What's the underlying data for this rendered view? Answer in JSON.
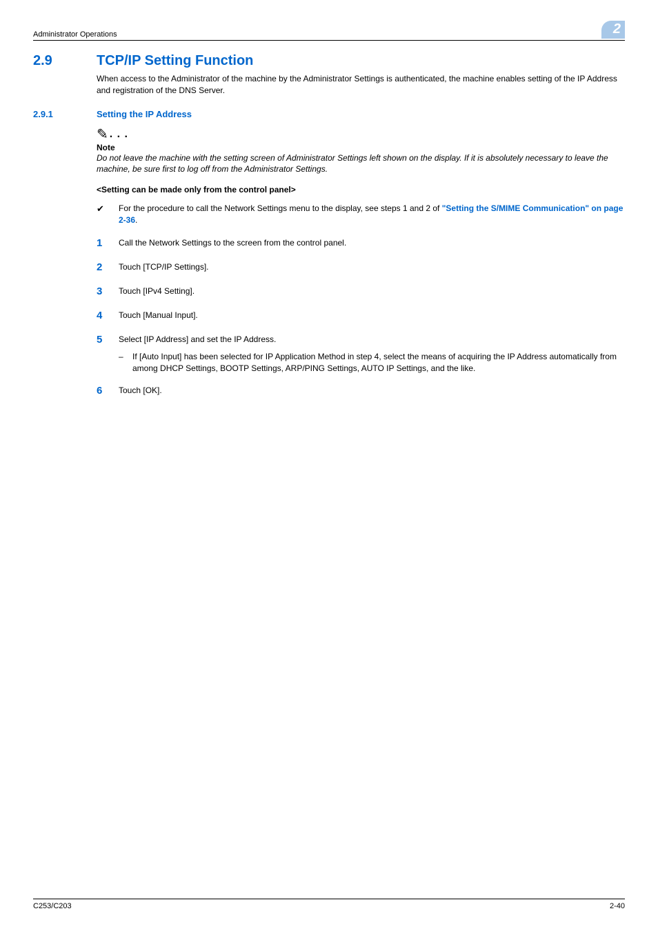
{
  "header": {
    "breadcrumb": "Administrator Operations",
    "chapter_num": "2"
  },
  "section29": {
    "num": "2.9",
    "title": "TCP/IP Setting Function",
    "intro": "When access to the Administrator of the machine by the Administrator Settings is authenticated, the machine enables setting of the IP Address and registration of the DNS Server."
  },
  "section291": {
    "num": "2.9.1",
    "title": "Setting the IP Address"
  },
  "note": {
    "icon": "✎",
    "dots": ". . .",
    "label": "Note",
    "text": "Do not leave the machine with the setting screen of Administrator Settings left shown on the display. If it is absolutely necessary to leave the machine, be sure first to log off from the Administrator Settings."
  },
  "panel_title": "<Setting can be made only from the control panel>",
  "checkmark": {
    "icon": "✔",
    "text_prefix": "For the procedure to call the Network Settings menu to the display, see steps 1 and 2 of ",
    "link": "\"Setting the S/MIME Communication\" on page 2-36",
    "text_suffix": "."
  },
  "steps": [
    {
      "num": "1",
      "text": "Call the Network Settings to the screen from the control panel."
    },
    {
      "num": "2",
      "text": "Touch [TCP/IP Settings]."
    },
    {
      "num": "3",
      "text": "Touch [IPv4 Setting]."
    },
    {
      "num": "4",
      "text": "Touch [Manual Input]."
    },
    {
      "num": "5",
      "text": "Select [IP Address] and set the IP Address.",
      "sub": "If [Auto Input] has been selected for IP Application Method in step 4, select the means of acquiring the IP Address automatically from among DHCP Settings, BOOTP Settings, ARP/PING Settings, AUTO IP Settings, and the like."
    },
    {
      "num": "6",
      "text": "Touch [OK]."
    }
  ],
  "footer": {
    "left": "C253/C203",
    "right": "2-40"
  }
}
